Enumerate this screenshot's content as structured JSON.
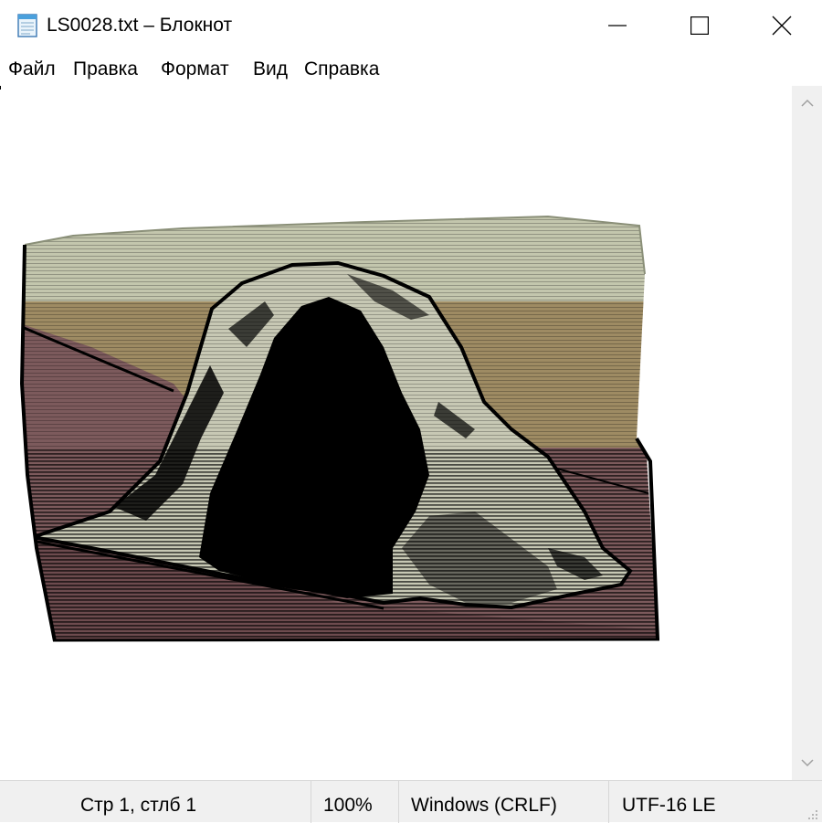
{
  "window": {
    "title": "LS0028.txt – Блокнот",
    "app_icon": "notepad-icon",
    "controls": [
      "minimize-icon",
      "maximize-icon",
      "close-icon"
    ]
  },
  "menu": {
    "items": [
      {
        "label": "Файл"
      },
      {
        "label": "Правка"
      },
      {
        "label": "Формат"
      },
      {
        "label": "Вид"
      },
      {
        "label": "Справка"
      }
    ]
  },
  "editor": {
    "art": "ascii-art-stone-arch-image",
    "colors": {
      "sky": "#c3c6ad",
      "sky_band": "#9e8b63",
      "ground": "#7c5a5c",
      "rock": "#c7c8b4",
      "ink": "#000000"
    }
  },
  "scrollbar": {
    "up_icon": "scroll-up-icon",
    "down_icon": "scroll-down-icon"
  },
  "status": {
    "position": "Стр 1, стлб 1",
    "zoom": "100%",
    "line_endings": "Windows (CRLF)",
    "encoding": "UTF-16 LE"
  }
}
